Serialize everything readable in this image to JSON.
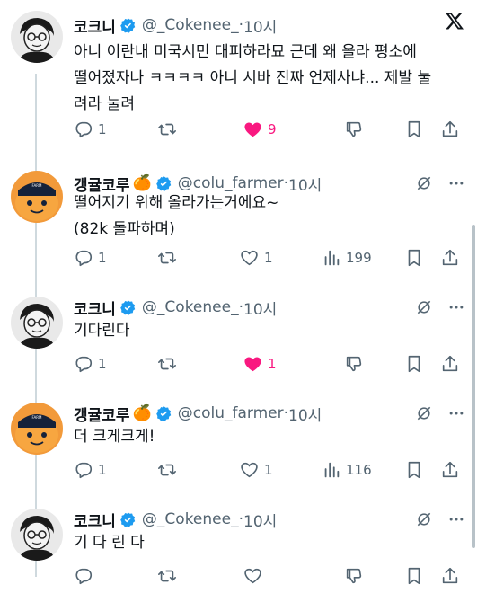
{
  "tweets": [
    {
      "name": "코크니",
      "handle": "@_Cokenee_",
      "dot": "·",
      "time": "10시",
      "lines": [
        "아니 이란내 미국시민 대피하라묘 근데 왜 올라 평소에",
        "떨어졌자나 ㅋㅋㅋㅋ 아니 시바 진짜 언제사냐... 제발 눌",
        "려라 눌려"
      ],
      "reply_count": "1",
      "retweet_count": "",
      "like_count": "9",
      "liked": true
    },
    {
      "name": "갱귤코루",
      "emoji": "🍊",
      "handle": "@colu_farmer",
      "dot": "·",
      "time": "10시",
      "lines": [
        "떨어지기 위해 올라가는거에요~",
        "(82k 돌파하며)"
      ],
      "reply_count": "1",
      "retweet_count": "",
      "like_count": "1",
      "views_count": "199",
      "liked": false
    },
    {
      "name": "코크니",
      "handle": "@_Cokenee_",
      "dot": "·",
      "time": "10시",
      "lines": [
        "기다린다"
      ],
      "reply_count": "1",
      "retweet_count": "",
      "like_count": "1",
      "liked": true
    },
    {
      "name": "갱귤코루",
      "emoji": "🍊",
      "handle": "@colu_farmer",
      "dot": "·",
      "time": "10시",
      "lines": [
        "더 크게크게!"
      ],
      "reply_count": "1",
      "retweet_count": "",
      "like_count": "1",
      "views_count": "116",
      "liked": false
    },
    {
      "name": "코크니",
      "handle": "@_Cokenee_",
      "dot": "·",
      "time": "10시",
      "lines": [
        "기 다 린 다"
      ],
      "reply_count": "",
      "retweet_count": "",
      "like_count": "",
      "liked": false
    }
  ],
  "colors": {
    "verified": "#1d9bf0",
    "like": "#f91880",
    "muted": "#536471",
    "line": "#cfd9de"
  }
}
